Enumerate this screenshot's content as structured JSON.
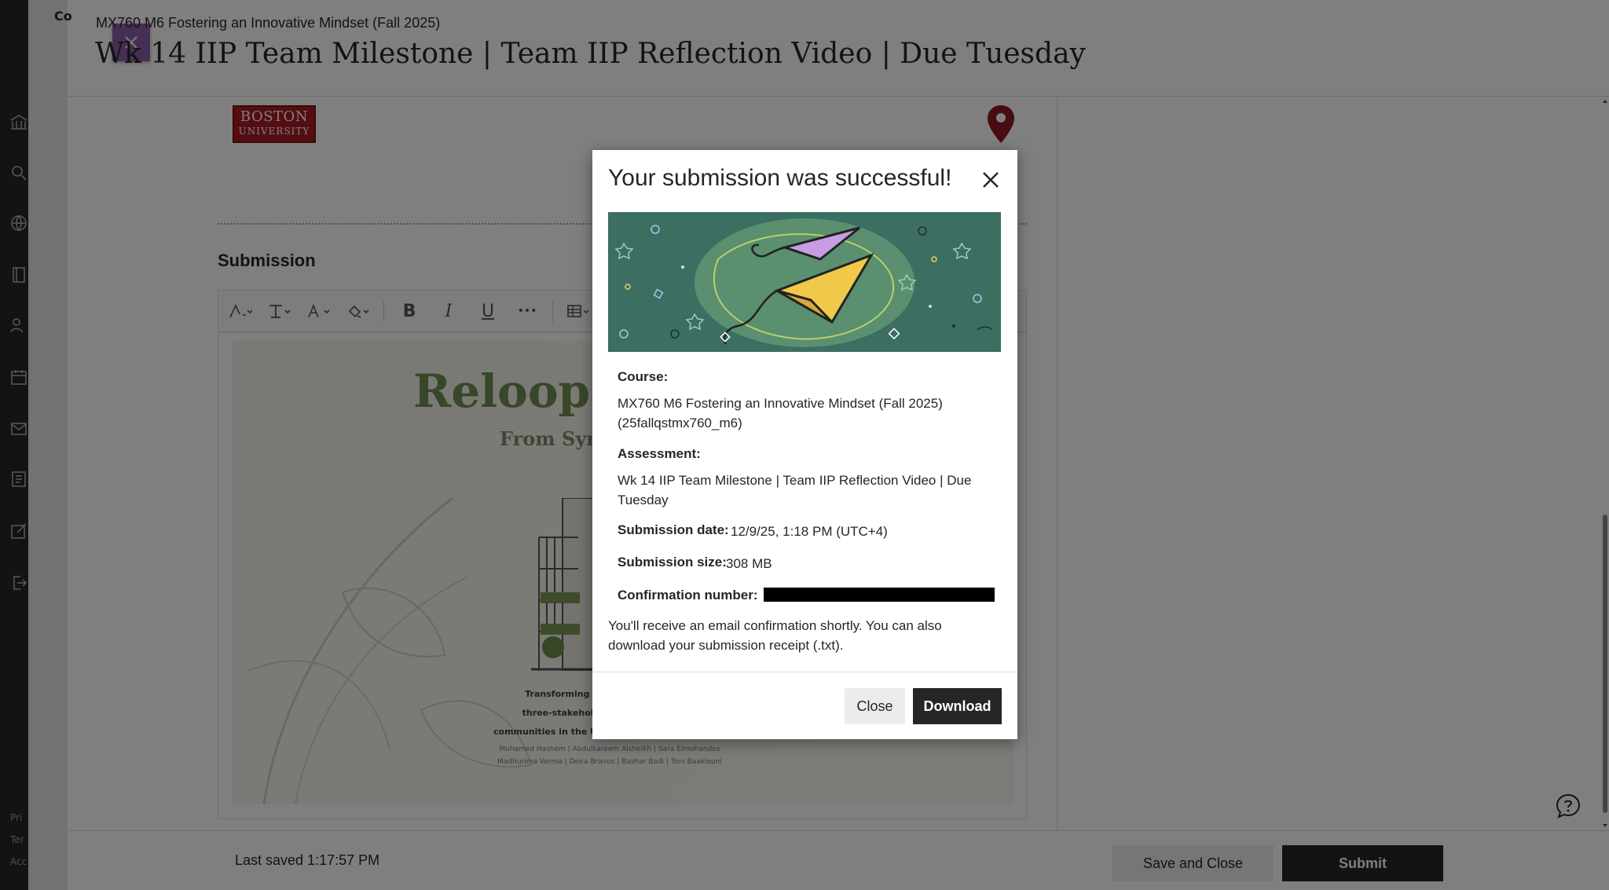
{
  "panel": {
    "cc_label": "Co",
    "course_name": "MX760 M6 Fostering an Innovative Mindset (Fall 2025)",
    "title": "Wk 14 IIP Team Milestone | Team IIP Reflection Video | Due Tuesday"
  },
  "logo": {
    "line1": "BOSTON",
    "line2": "UNIVERSITY"
  },
  "content": {
    "section_label": "Submission",
    "doc_title": "Reloop I",
    "doc_subtitle": "From Sym",
    "doc_desc_1": "Transforming recycling from",
    "doc_desc_2": "three-stakeholder service mo",
    "doc_desc_3": "communities in the United Arab Emirates",
    "doc_authors_1": "Mohamed Hashem | Abdulkareem Alsheikh | Sara Elmohandes",
    "doc_authors_2": "Madhurima Verma | Deira Bravos | Bashar Badi | Toni Baaklouni"
  },
  "toolbar": {
    "bold": "B",
    "italic": "I",
    "underline": "U",
    "more": "•••"
  },
  "footer": {
    "last_saved": "Last saved 1:17:57 PM",
    "save_close": "Save and Close",
    "submit": "Submit"
  },
  "left_nav": {
    "text_1": "Pri",
    "text_2": "Ter",
    "text_3": "Acc"
  },
  "modal": {
    "title": "Your submission was successful!",
    "course_label": "Course:",
    "course_value": "MX760 M6 Fostering an Innovative Mindset (Fall 2025) (25fallqstmx760_m6)",
    "assessment_label": "Assessment:",
    "assessment_value": "Wk 14 IIP Team Milestone | Team IIP Reflection Video | Due Tuesday",
    "date_label": "Submission date:",
    "date_value": "12/9/25, 1:18 PM (UTC+4)",
    "size_label": "Submission size:",
    "size_value": "308 MB",
    "confirmation_label": "Confirmation number:",
    "receipt_note": "You'll receive an email confirmation shortly. You can also download your submission receipt (.txt).",
    "close_label": "Close",
    "download_label": "Download"
  },
  "colors": {
    "accent_purple": "#8b5ea8",
    "bu_red": "#a81d24",
    "banner_teal": "#3d6e62",
    "primary_dark": "#262626"
  }
}
